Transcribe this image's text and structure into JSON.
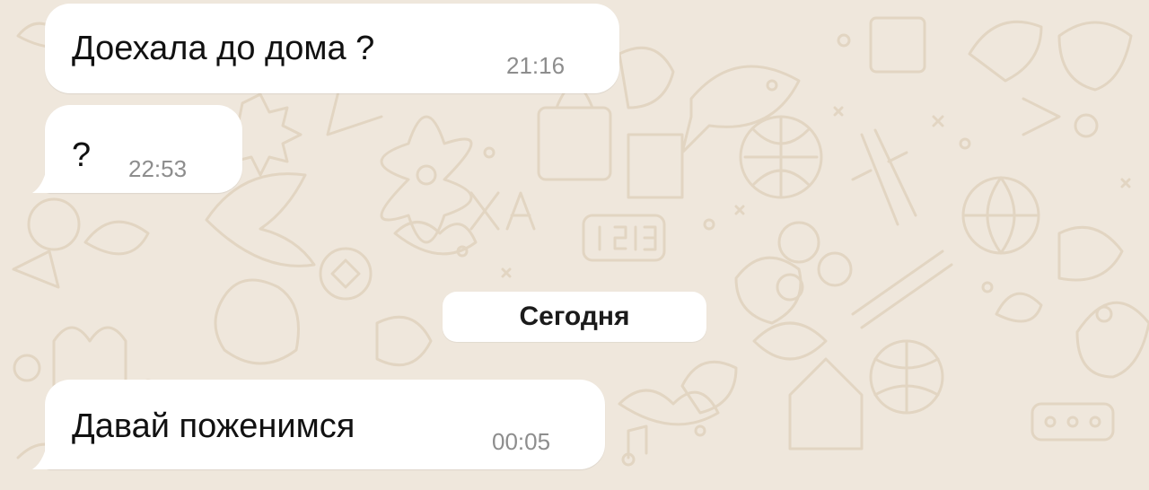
{
  "chat": {
    "messages": [
      {
        "text": "Доехала до дома ?",
        "time": "21:16"
      },
      {
        "text": "?",
        "time": "22:53"
      },
      {
        "text": "Давай поженимся",
        "time": "00:05"
      }
    ],
    "date_separator": "Сегодня"
  },
  "colors": {
    "wallpaper": "#efe7dc",
    "doodle": "#e3d6c4",
    "bubble": "#ffffff",
    "timestamp": "#8d8d8d"
  }
}
